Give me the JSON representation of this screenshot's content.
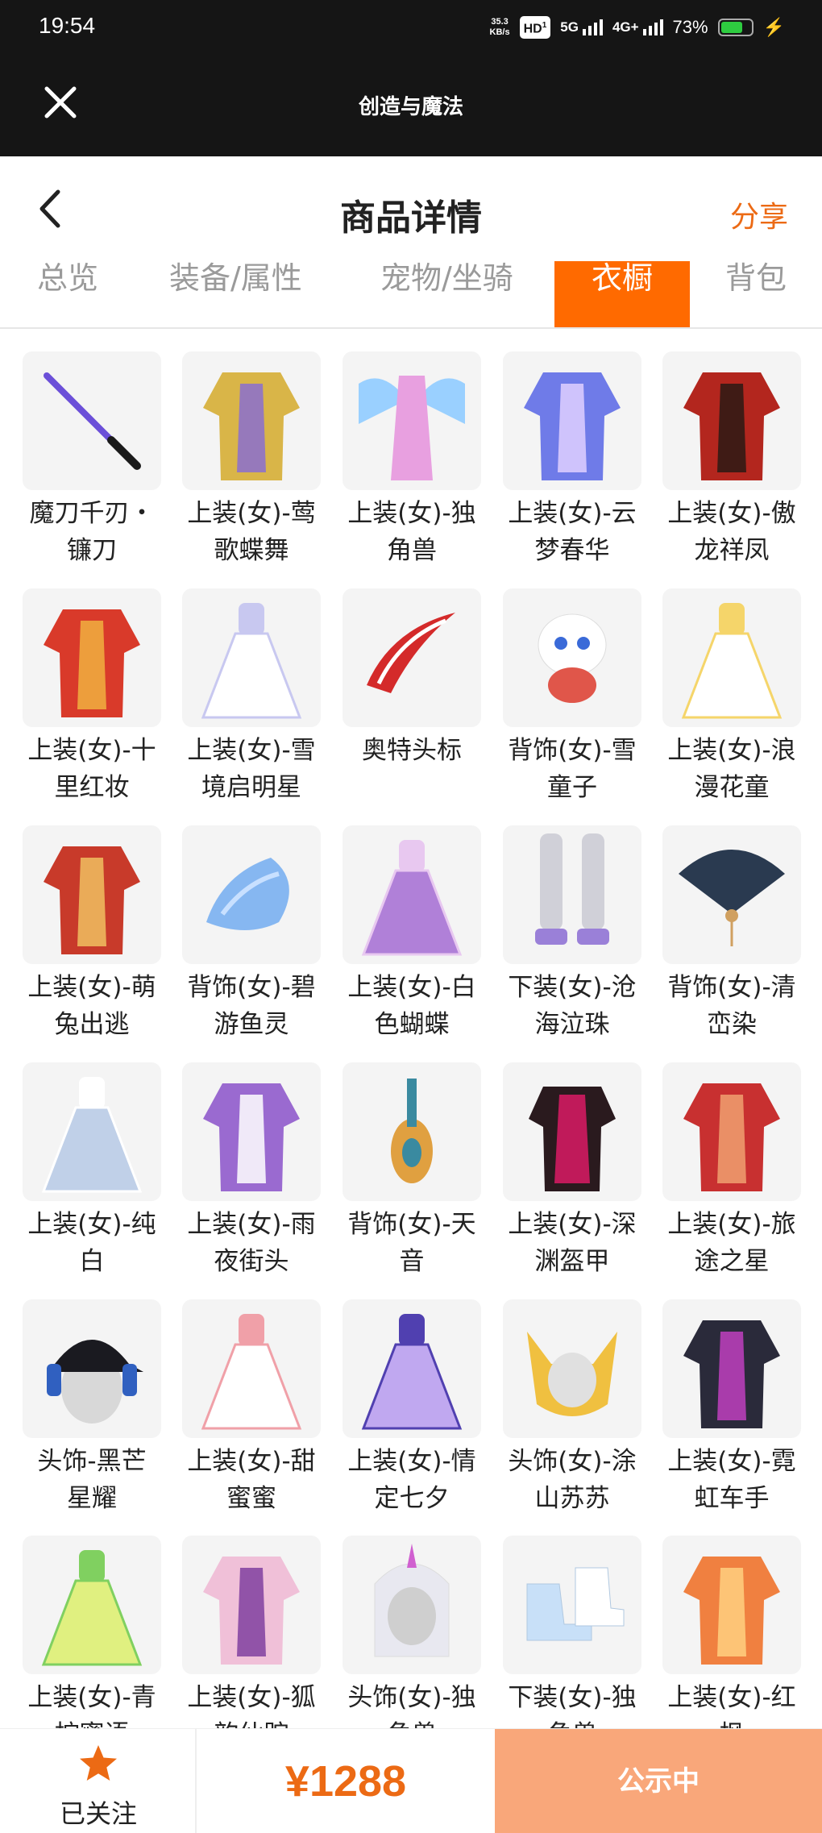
{
  "status_bar": {
    "time": "19:54",
    "net_speed_value": "35.3",
    "net_speed_unit": "KB/s",
    "hd_badge": "HD",
    "hd_sub": "1",
    "sig1_label": "5G",
    "sig2_label": "4G+",
    "battery_percent": "73%",
    "battery_level": 0.73
  },
  "app_bar": {
    "title": "创造与魔法",
    "close_icon": "close-icon"
  },
  "header": {
    "title": "商品详情",
    "share_label": "分享",
    "back_icon": "chevron-left-icon"
  },
  "tabs": [
    {
      "label": "总览",
      "active": false
    },
    {
      "label": "装备/属性",
      "active": false
    },
    {
      "label": "宠物/坐骑",
      "active": false
    },
    {
      "label": "衣橱",
      "active": true
    },
    {
      "label": "背包",
      "active": false
    }
  ],
  "wardrobe_items": [
    {
      "name": "魔刀千刃・镰刀",
      "line1": "魔刀千刃・",
      "line2": "镰刀",
      "icon": "blade-icon"
    },
    {
      "name": "上装(女)-莺歌蝶舞",
      "line1": "上装(女)-莺",
      "line2": "歌蝶舞",
      "icon": "outfit-icon"
    },
    {
      "name": "上装(女)-独角兽",
      "line1": "上装(女)-独",
      "line2": "角兽",
      "icon": "winged-dress-icon"
    },
    {
      "name": "上装(女)-云梦春华",
      "line1": "上装(女)-云",
      "line2": "梦春华",
      "icon": "outfit-icon"
    },
    {
      "name": "上装(女)-傲龙祥凤",
      "line1": "上装(女)-傲",
      "line2": "龙祥凤",
      "icon": "outfit-icon"
    },
    {
      "name": "上装(女)-十里红妆",
      "line1": "上装(女)-十",
      "line2": "里红妆",
      "icon": "outfit-icon"
    },
    {
      "name": "上装(女)-雪境启明星",
      "line1": "上装(女)-雪",
      "line2": "境启明星",
      "icon": "dress-icon"
    },
    {
      "name": "奥特头标",
      "line1": "奥特头标",
      "line2": "",
      "icon": "headband-icon"
    },
    {
      "name": "背饰(女)-雪童子",
      "line1": "背饰(女)-雪",
      "line2": "童子",
      "icon": "snow-doll-icon"
    },
    {
      "name": "上装(女)-浪漫花童",
      "line1": "上装(女)-浪",
      "line2": "漫花童",
      "icon": "dress-icon"
    },
    {
      "name": "上装(女)-萌兔出逃",
      "line1": "上装(女)-萌",
      "line2": "兔出逃",
      "icon": "outfit-icon"
    },
    {
      "name": "背饰(女)-碧游鱼灵",
      "line1": "背饰(女)-碧",
      "line2": "游鱼灵",
      "icon": "water-spirit-icon"
    },
    {
      "name": "上装(女)-白色蝴蝶",
      "line1": "上装(女)-白",
      "line2": "色蝴蝶",
      "icon": "dress-icon"
    },
    {
      "name": "下装(女)-沧海泣珠",
      "line1": "下装(女)-沧",
      "line2": "海泣珠",
      "icon": "legs-icon"
    },
    {
      "name": "背饰(女)-清峦染",
      "line1": "背饰(女)-清",
      "line2": "峦染",
      "icon": "fan-icon"
    },
    {
      "name": "上装(女)-纯白",
      "line1": "上装(女)-纯",
      "line2": "白",
      "icon": "dress-icon"
    },
    {
      "name": "上装(女)-雨夜街头",
      "line1": "上装(女)-雨",
      "line2": "夜街头",
      "icon": "outfit-icon"
    },
    {
      "name": "背饰(女)-天音",
      "line1": "背饰(女)-天",
      "line2": "音",
      "icon": "lute-icon"
    },
    {
      "name": "上装(女)-深渊盔甲",
      "line1": "上装(女)-深",
      "line2": "渊盔甲",
      "icon": "armor-icon"
    },
    {
      "name": "上装(女)-旅途之星",
      "line1": "上装(女)-旅",
      "line2": "途之星",
      "icon": "outfit-icon"
    },
    {
      "name": "头饰-黑芒星耀",
      "line1": "头饰-黑芒",
      "line2": "星耀",
      "icon": "cap-headphones-icon"
    },
    {
      "name": "上装(女)-甜蜜蜜",
      "line1": "上装(女)-甜",
      "line2": "蜜蜜",
      "icon": "dress-icon"
    },
    {
      "name": "上装(女)-情定七夕",
      "line1": "上装(女)-情",
      "line2": "定七夕",
      "icon": "dress-icon"
    },
    {
      "name": "头饰(女)-涂山苏苏",
      "line1": "头饰(女)-涂",
      "line2": "山苏苏",
      "icon": "fox-head-icon"
    },
    {
      "name": "上装(女)-霓虹车手",
      "line1": "上装(女)-霓",
      "line2": "虹车手",
      "icon": "outfit-icon"
    },
    {
      "name": "上装(女)-青",
      "line1": "上装(女)-青",
      "line2": "柠蜜语",
      "icon": "dress-icon"
    },
    {
      "name": "上装(女)-狐",
      "line1": "上装(女)-狐",
      "line2": "韵仙踪",
      "icon": "outfit-icon"
    },
    {
      "name": "头饰(女)-独角兽",
      "line1": "头饰(女)-独",
      "line2": "角兽",
      "icon": "unicorn-hood-icon"
    },
    {
      "name": "下装(女)-独角兽",
      "line1": "下装(女)-独",
      "line2": "角兽",
      "icon": "boots-icon"
    },
    {
      "name": "上装(女)-红枫",
      "line1": "上装(女)-红",
      "line2": "枫",
      "icon": "outfit-icon"
    }
  ],
  "bottom_bar": {
    "follow_label": "已关注",
    "follow_icon": "star-icon",
    "price": "¥1288",
    "status_button": "公示中"
  },
  "colors": {
    "accent": "#ec6a14",
    "tab_active_bg": "#ff6a00",
    "status_button_bg": "#f9a77a",
    "dark_bar": "#151515"
  }
}
